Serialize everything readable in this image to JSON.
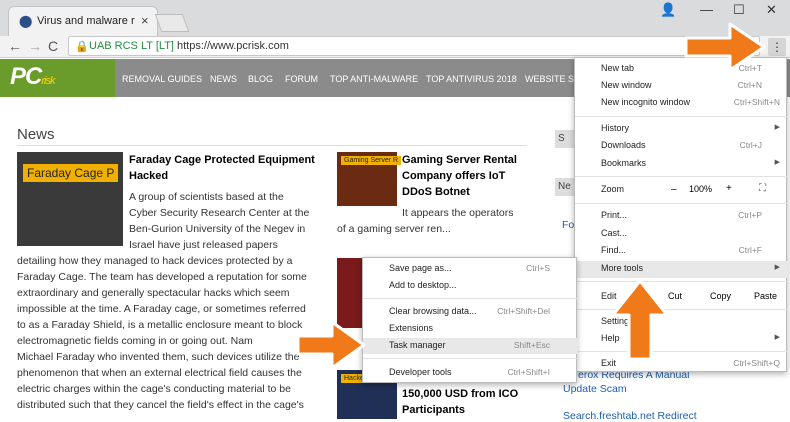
{
  "browser": {
    "tab_title": "Virus and malware remo",
    "tab_close": "×",
    "window_controls": {
      "minimize": "—",
      "maximize": "☐",
      "close": "✕"
    },
    "back": "←",
    "forward": "→",
    "reload": "C",
    "site_identity": "UAB RCS LT [LT]",
    "url": "https://www.pcrisk.com",
    "star": "☆",
    "menu_glyph": "⋮"
  },
  "site": {
    "logo_main": "PC",
    "logo_sub": "risk",
    "nav": [
      "REMOVAL GUIDES",
      "NEWS",
      "BLOG",
      "FORUM",
      "TOP ANTI-MALWARE",
      "TOP ANTIVIRUS 2018",
      "WEBSITE SC"
    ]
  },
  "page": {
    "news_heading": "News",
    "article1": {
      "thumb_label": "Faraday Cage P",
      "title_lines": [
        "Faraday Cage Protected Equipment",
        "Hacked"
      ],
      "body_lines_short": [
        "A group of scientists based at the",
        "Cyber Security Research Center at the",
        "Ben-Gurion University of the Negev in",
        "Israel have just released papers"
      ],
      "body_lines_full": [
        "detailing how they managed to hack devices protected by a",
        "Faraday Cage. The team has developed a reputation for some",
        "extraordinary and generally spectacular hacks which seem",
        "impossible at the time. A Faraday cage, or sometimes referred",
        "to as a Faraday Shield, is a metallic enclosure meant to block",
        "electromagnetic fields coming in or going out. Nam",
        "Michael Faraday who invented them, such devices utilize the",
        "phenomenon that when an external electrical field causes the",
        "electric charges within the cage's conducting material to be",
        "distributed such that they cancel the field's effect in the cage's"
      ]
    },
    "article2": {
      "thumb_label": "Gaming Server R",
      "title_lines": [
        "Gaming Server Rental",
        "Company offers IoT",
        "DDoS Botnet"
      ],
      "body_lines": [
        "It appears the operators",
        "of a gaming server ren..."
      ]
    },
    "article3": {
      "thumb_label": "Hacker Steals o",
      "title_lines": [
        "150,000 USD from ICO",
        "Participants"
      ]
    },
    "sidebar": {
      "box_s": "S",
      "box_ne": "Ne",
      "fo": "Fo",
      "link1": "erox Requires A Manual",
      "link1b": "Update Scam",
      "link2": "Search.freshtab.net Redirect"
    }
  },
  "chrome_menu": {
    "items": [
      {
        "label": "New tab",
        "shortcut": "Ctrl+T"
      },
      {
        "label": "New window",
        "shortcut": "Ctrl+N"
      },
      {
        "label": "New incognito window",
        "shortcut": "Ctrl+Shift+N"
      },
      {
        "label": "History",
        "shortcut": ""
      },
      {
        "label": "Downloads",
        "shortcut": "Ctrl+J"
      },
      {
        "label": "Bookmarks",
        "shortcut": ""
      },
      {
        "label": "Zoom",
        "shortcut": ""
      },
      {
        "label": "Print...",
        "shortcut": "Ctrl+P"
      },
      {
        "label": "Cast...",
        "shortcut": ""
      },
      {
        "label": "Find...",
        "shortcut": "Ctrl+F"
      },
      {
        "label": "More tools",
        "shortcut": ""
      },
      {
        "label": "Edit",
        "shortcut": ""
      },
      {
        "label": "Settings",
        "shortcut": ""
      },
      {
        "label": "Help",
        "shortcut": ""
      },
      {
        "label": "Exit",
        "shortcut": "Ctrl+Shift+Q"
      }
    ],
    "zoom": {
      "minus": "–",
      "value": "100%",
      "plus": "+",
      "fullscreen": "⛶"
    },
    "edit": {
      "cut": "Cut",
      "copy": "Copy",
      "paste": "Paste"
    },
    "arrow": "▶"
  },
  "more_tools": {
    "items": [
      {
        "label": "Save page as...",
        "shortcut": "Ctrl+S"
      },
      {
        "label": "Add to desktop...",
        "shortcut": ""
      },
      {
        "label": "Clear browsing data...",
        "shortcut": "Ctrl+Shift+Del"
      },
      {
        "label": "Extensions",
        "shortcut": ""
      },
      {
        "label": "Task manager",
        "shortcut": "Shift+Esc"
      },
      {
        "label": "Developer tools",
        "shortcut": "Ctrl+Shift+I"
      }
    ]
  },
  "colors": {
    "arrow": "#f07a1a",
    "logo_green": "#6a9c2c",
    "nav_gray": "#8b8b8b",
    "link_blue": "#1c5fb0"
  }
}
